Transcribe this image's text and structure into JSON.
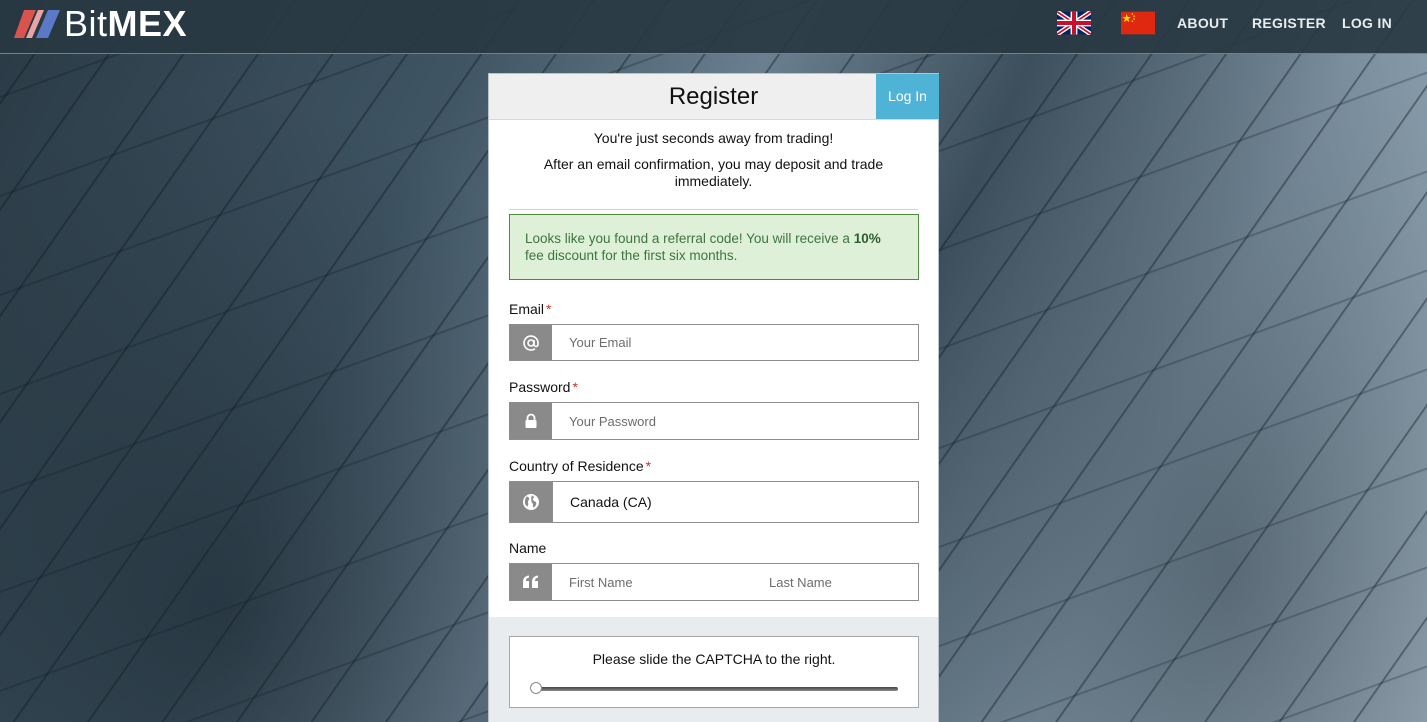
{
  "header": {
    "logo_text_light": "Bit",
    "logo_text_bold": "MEX",
    "nav": {
      "about": "ABOUT",
      "register": "REGISTER",
      "login": "LOG IN"
    },
    "flags": [
      "uk-flag-icon",
      "china-flag-icon"
    ]
  },
  "panel": {
    "title": "Register",
    "login_tab": "Log In",
    "intro_line1": "You're just seconds away from trading!",
    "intro_line2": "After an email confirmation, you may deposit and trade immediately.",
    "referral": {
      "before": "Looks like you found a referral code! You will receive a ",
      "highlight": "10%",
      "after": " fee discount for the first six months."
    },
    "form": {
      "email": {
        "label": "Email",
        "required": "*",
        "placeholder": "Your Email",
        "icon": "at-icon"
      },
      "password": {
        "label": "Password",
        "required": "*",
        "placeholder": "Your Password",
        "icon": "lock-icon"
      },
      "country": {
        "label": "Country of Residence",
        "required": "*",
        "value": "Canada (CA)",
        "icon": "globe-icon"
      },
      "name": {
        "label": "Name",
        "first_placeholder": "First Name",
        "last_placeholder": "Last Name",
        "icon": "quote-icon"
      }
    },
    "captcha": {
      "text": "Please slide the CAPTCHA to the right.",
      "progress": 0
    }
  },
  "colors": {
    "accent_tab": "#4fb3d6",
    "referral_bg": "#dff0d8",
    "referral_text": "#3c763d",
    "required": "#c9302c",
    "addon_bg": "#8a8a8a",
    "logo_mark_red": "#d9534f",
    "logo_mark_blue": "#5b79c6"
  }
}
